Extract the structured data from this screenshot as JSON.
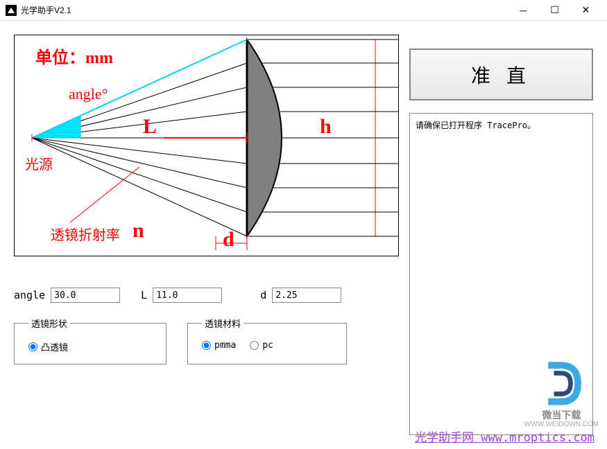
{
  "window": {
    "title": "光学助手V2.1"
  },
  "diagram": {
    "unit_label": "单位：mm",
    "angle_label": "angle°",
    "L_label": "L",
    "source_label": "光源",
    "refraction_label": "透镜折射率",
    "n_label": "n",
    "d_label": "d",
    "h_label": "h"
  },
  "inputs": {
    "angle": {
      "label": "angle",
      "value": "30.0"
    },
    "L": {
      "label": "L",
      "value": "11.0"
    },
    "d": {
      "label": "d",
      "value": "2.25"
    }
  },
  "lens_shape": {
    "legend": "透镜形状",
    "options": {
      "convex": "凸透镜"
    },
    "selected": "convex"
  },
  "lens_material": {
    "legend": "透镜材料",
    "options": {
      "pmma": "pmma",
      "pc": "pc"
    },
    "selected": "pmma"
  },
  "action_button": "准  直",
  "message": "请确保已打开程序 TracePro。",
  "watermark": {
    "text": "微当下载",
    "url": "WWW.WEIDOWN.COM"
  },
  "footer": {
    "text": "光学助手网",
    "url": "www.mroptics.com"
  }
}
